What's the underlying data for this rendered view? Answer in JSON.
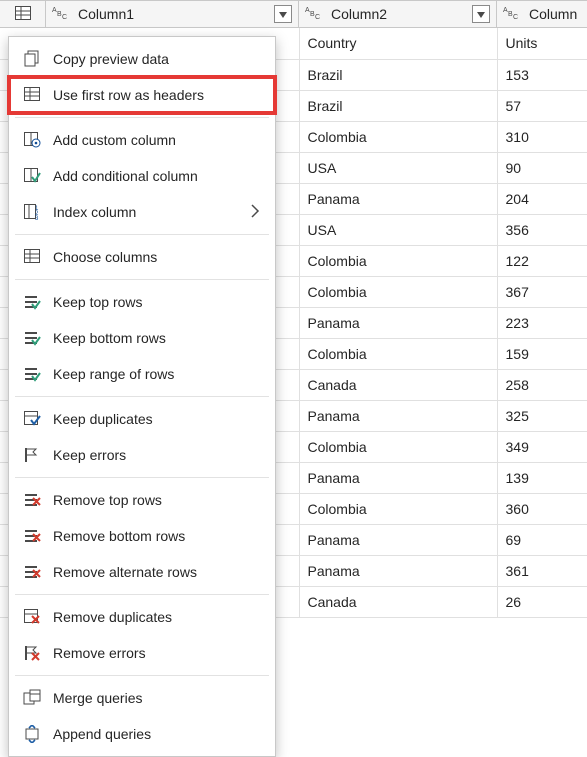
{
  "columns": {
    "col1": "Column1",
    "col2": "Column2",
    "col3": "Column"
  },
  "rows": [
    {
      "c2": "Country",
      "c3": "Units"
    },
    {
      "c2": "Brazil",
      "c3": "153"
    },
    {
      "c2": "Brazil",
      "c3": "57"
    },
    {
      "c2": "Colombia",
      "c3": "310"
    },
    {
      "c2": "USA",
      "c3": "90"
    },
    {
      "c2": "Panama",
      "c3": "204"
    },
    {
      "c2": "USA",
      "c3": "356"
    },
    {
      "c2": "Colombia",
      "c3": "122"
    },
    {
      "c2": "Colombia",
      "c3": "367"
    },
    {
      "c2": "Panama",
      "c3": "223"
    },
    {
      "c2": "Colombia",
      "c3": "159"
    },
    {
      "c2": "Canada",
      "c3": "258"
    },
    {
      "c2": "Panama",
      "c3": "325"
    },
    {
      "c2": "Colombia",
      "c3": "349"
    },
    {
      "c2": "Panama",
      "c3": "139"
    },
    {
      "c2": "Colombia",
      "c3": "360"
    },
    {
      "c2": "Panama",
      "c3": "69"
    },
    {
      "c2": "Panama",
      "c3": "361"
    },
    {
      "c2": "Canada",
      "c3": "26"
    }
  ],
  "menu": {
    "copy_preview": "Copy preview data",
    "use_first_row": "Use first row as headers",
    "add_custom_column": "Add custom column",
    "add_conditional_col": "Add conditional column",
    "index_column": "Index column",
    "choose_columns": "Choose columns",
    "keep_top_rows": "Keep top rows",
    "keep_bottom_rows": "Keep bottom rows",
    "keep_range_rows": "Keep range of rows",
    "keep_duplicates": "Keep duplicates",
    "keep_errors": "Keep errors",
    "remove_top_rows": "Remove top rows",
    "remove_bottom_rows": "Remove bottom rows",
    "remove_alternate": "Remove alternate rows",
    "remove_duplicates": "Remove duplicates",
    "remove_errors": "Remove errors",
    "merge_queries": "Merge queries",
    "append_queries": "Append queries"
  }
}
